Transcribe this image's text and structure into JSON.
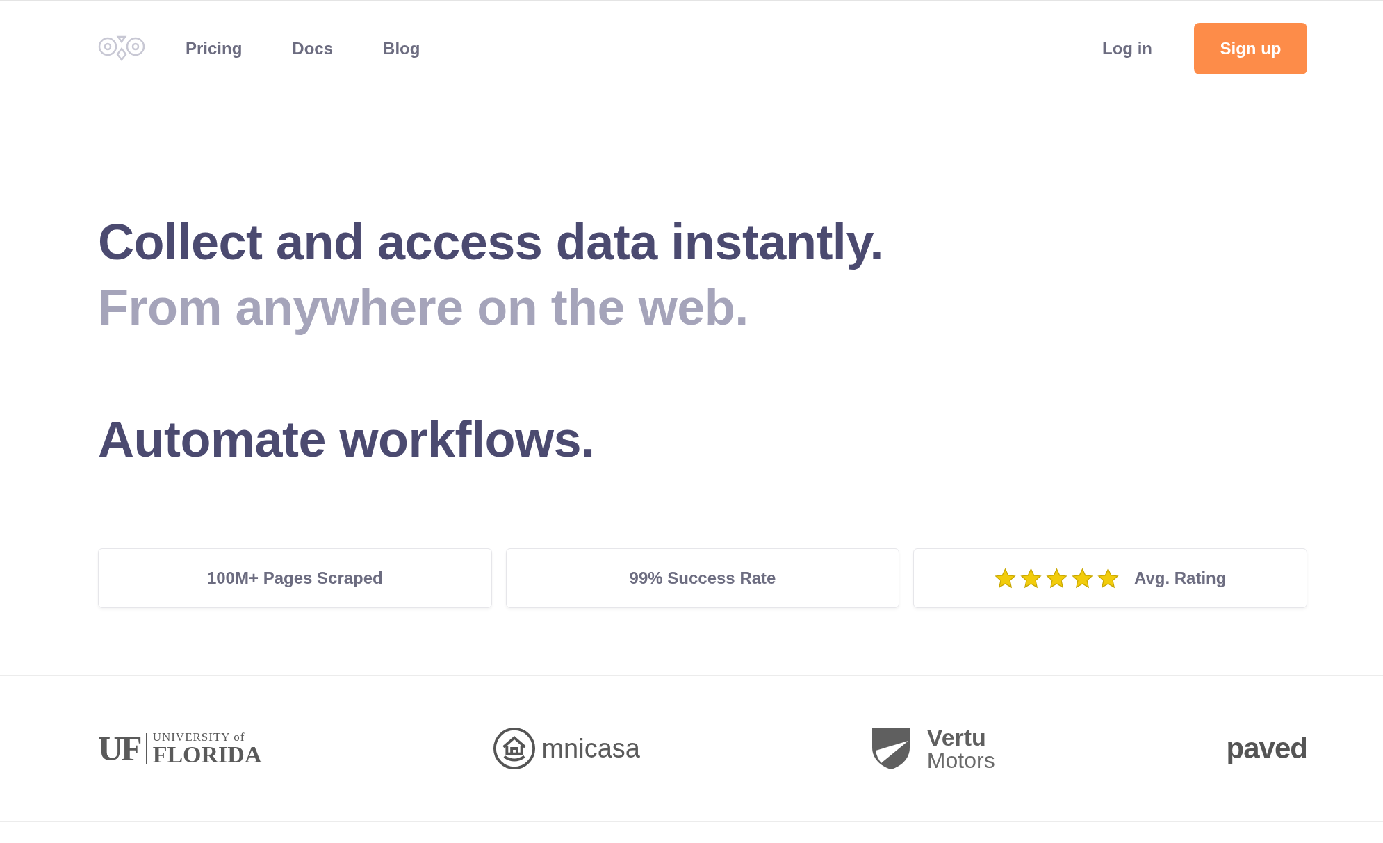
{
  "nav": {
    "links": [
      "Pricing",
      "Docs",
      "Blog"
    ],
    "login": "Log in",
    "signup": "Sign up"
  },
  "hero": {
    "headline": "Collect and access data instantly.",
    "subheadline": "From anywhere on the web.",
    "tagline": "Automate workflows."
  },
  "stats": [
    {
      "kind": "text",
      "label": "100M+ Pages Scraped"
    },
    {
      "kind": "text",
      "label": "99% Success Rate"
    },
    {
      "kind": "rating",
      "stars": 5,
      "label": "Avg. Rating"
    }
  ],
  "logos": [
    {
      "kind": "uf",
      "texts": [
        "UF",
        "UNIVERSITY of",
        "FLORIDA"
      ]
    },
    {
      "kind": "omnicasa",
      "texts": [
        "mnicasa"
      ]
    },
    {
      "kind": "vertu",
      "texts": [
        "Vertu",
        "Motors"
      ]
    },
    {
      "kind": "paved",
      "texts": [
        "paved"
      ]
    }
  ]
}
